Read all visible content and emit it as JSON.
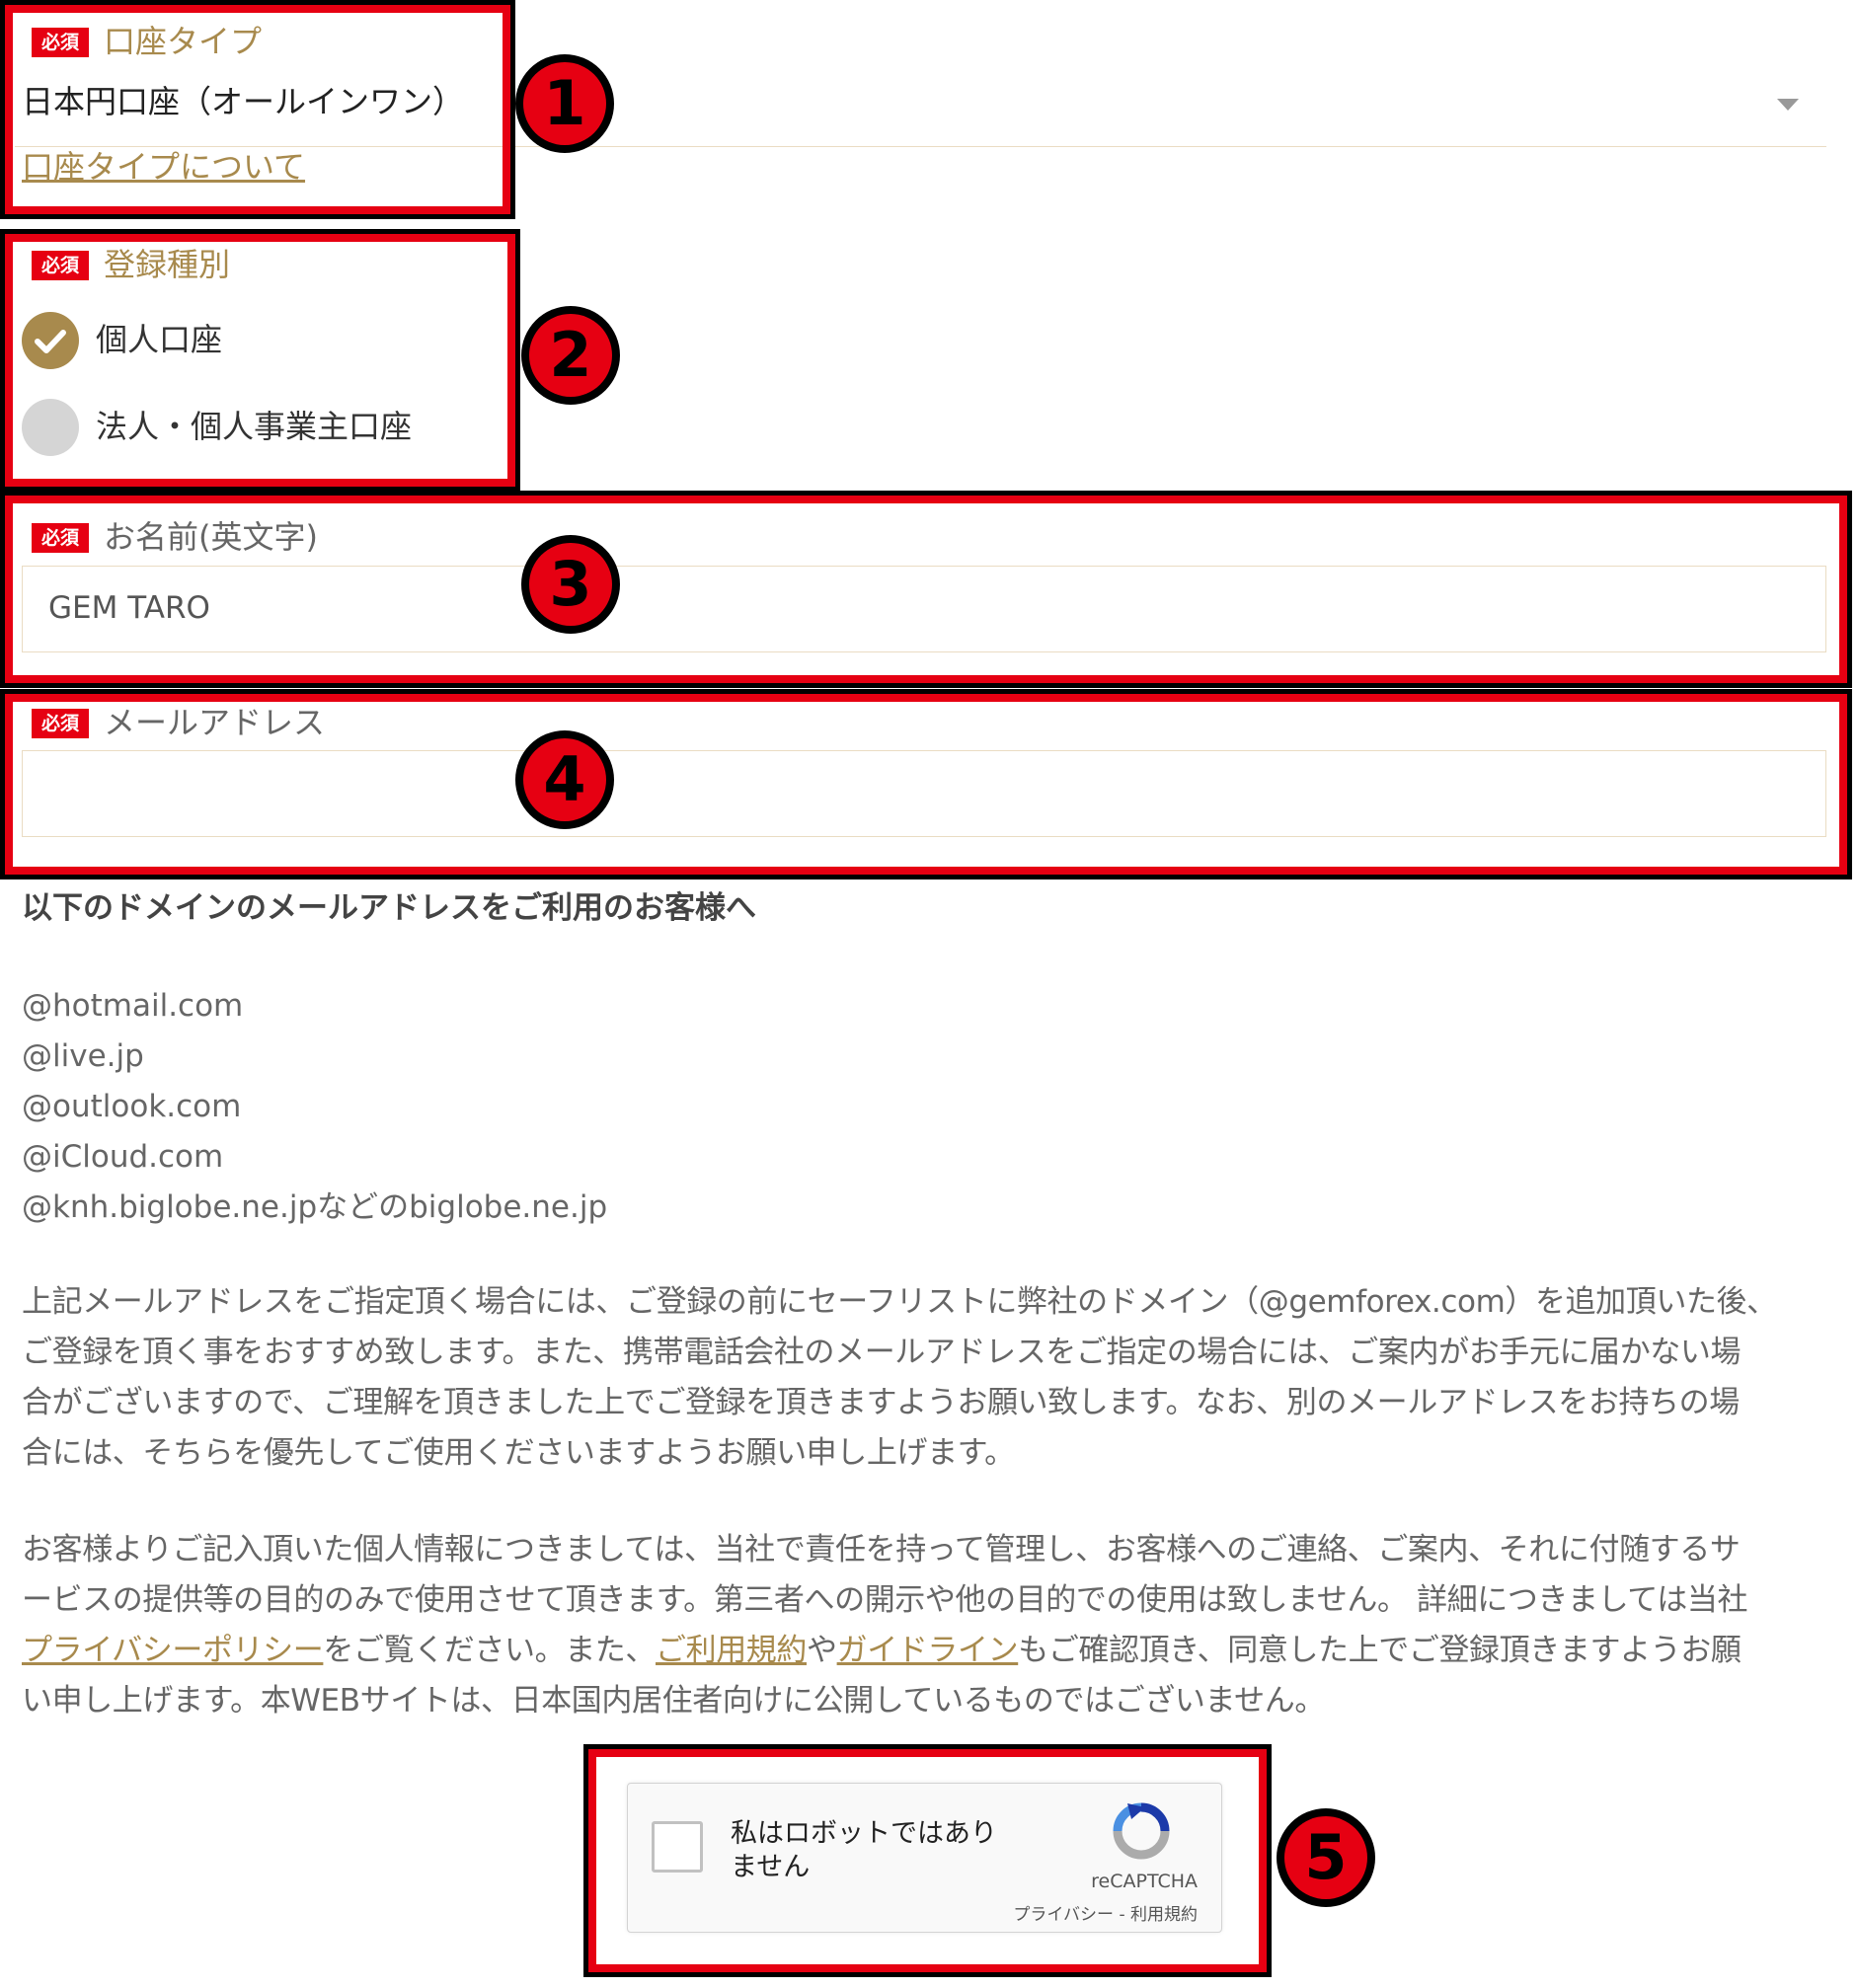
{
  "required_badge": "必須",
  "account_type": {
    "label": "口座タイプ",
    "value": "日本円口座（オールインワン）",
    "link": "口座タイプについて"
  },
  "registration_type": {
    "label": "登録種別",
    "options": [
      {
        "label": "個人口座",
        "selected": true
      },
      {
        "label": "法人・個人事業主口座",
        "selected": false
      }
    ]
  },
  "name_field": {
    "label": "お名前(英文字)",
    "value": "GEM TARO"
  },
  "email_field": {
    "label": "メールアドレス",
    "value": ""
  },
  "notice": {
    "heading": "以下のドメインのメールアドレスをご利用のお客様へ",
    "domains": [
      "@hotmail.com",
      "@live.jp",
      "@outlook.com",
      "@iCloud.com",
      "@knh.biglobe.ne.jpなどのbiglobe.ne.jp"
    ],
    "para1_lines": [
      "上記メールアドレスをご指定頂く場合には、ご登録の前にセーフリストに弊社のドメイン（@gemforex.com）を追加頂いた後、",
      "ご登録を頂く事をおすすめ致します。また、携帯電話会社のメールアドレスをご指定の場合には、ご案内がお手元に届かない場",
      "合がございますので、ご理解を頂きました上でご登録を頂きますようお願い致します。なお、別のメールアドレスをお持ちの場",
      "合には、そちらを優先してご使用くださいますようお願い申し上げます。"
    ],
    "para2_line1": "お客様よりご記入頂いた個人情報につきましては、当社で責任を持って管理し、お客様へのご連絡、ご案内、それに付随するサ",
    "para2_line2": "ービスの提供等の目的のみで使用させて頂きます。第三者への開示や他の目的での使用は致しません。 詳細につきましては当社",
    "privacy_link": "プライバシーポリシー",
    "para2_line3_mid": "をご覧ください。また、",
    "terms_link": "ご利用規約",
    "para2_ya": "や",
    "guideline_link": "ガイドライン",
    "para2_line3_end": "もご確認頂き、同意した上でご登録頂きますようお願",
    "para2_line4": "い申し上げます。本WEBサイトは、日本国内居住者向けに公開しているものではございません。"
  },
  "recaptcha": {
    "label_line1": "私はロボットではあり",
    "label_line2": "ません",
    "brand": "reCAPTCHA",
    "privacy": "プライバシー",
    "sep": " - ",
    "terms": "利用規約"
  },
  "badges": [
    "1",
    "2",
    "3",
    "4",
    "5"
  ],
  "colors": {
    "accent": "#a88a4d",
    "required": "#e60012",
    "highlight": "#e60012"
  }
}
